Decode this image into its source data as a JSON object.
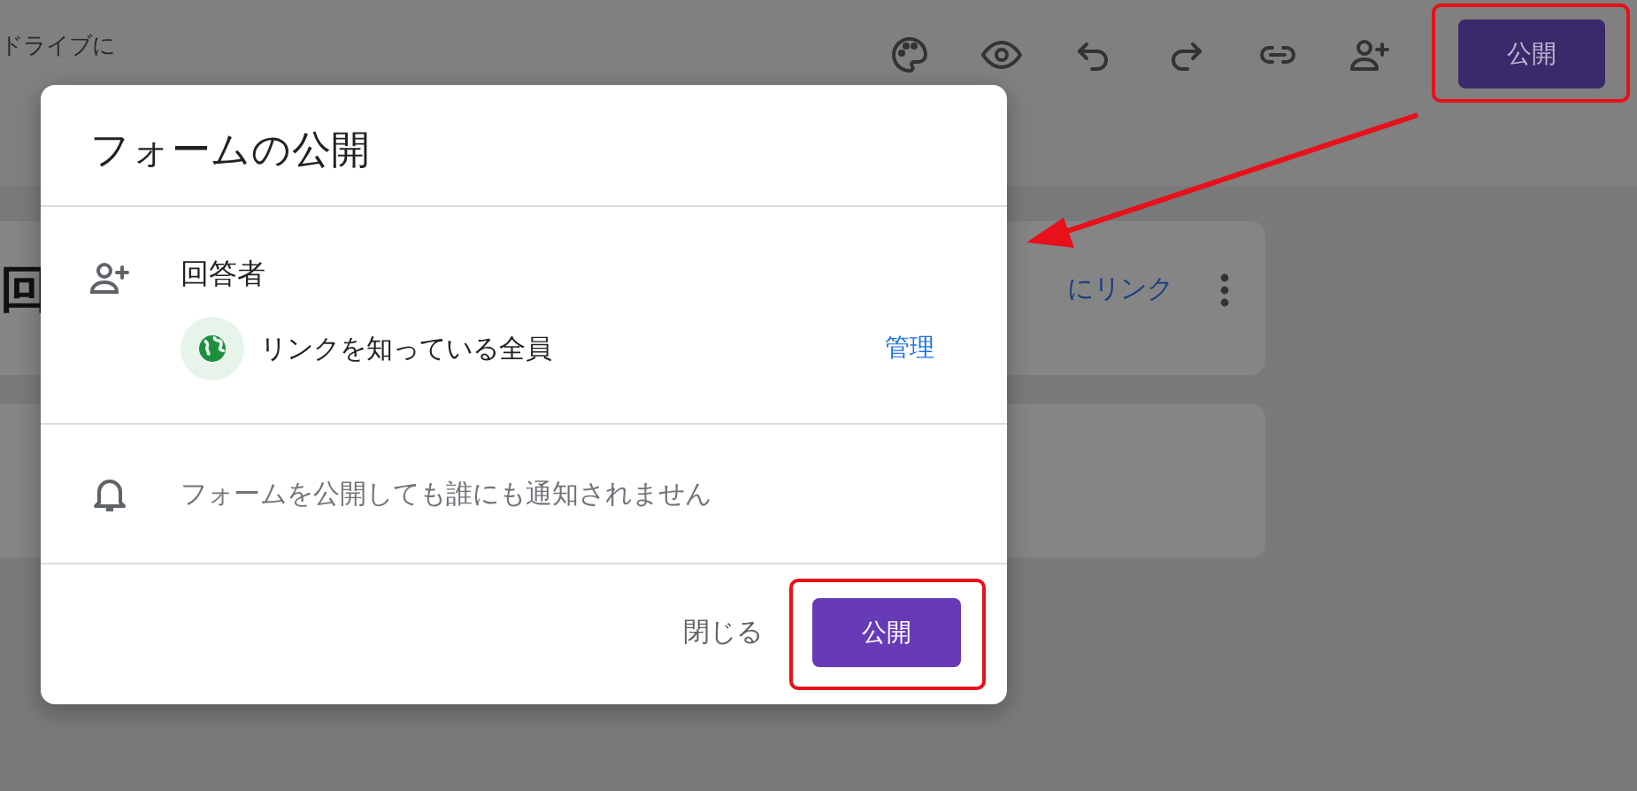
{
  "header": {
    "drive_text": "ドライブに",
    "publish_button": "公開"
  },
  "question_card": {
    "glyph": "回",
    "link": "にリンク"
  },
  "dialog": {
    "title": "フォームの公開",
    "respondents": {
      "heading": "回答者",
      "access": "リンクを知っている全員",
      "manage": "管理"
    },
    "notice": "フォームを公開しても誰にも通知されません",
    "buttons": [
      {
        "label": "閉じる",
        "kind": "text"
      },
      {
        "label": "公開",
        "kind": "primary"
      }
    ]
  }
}
